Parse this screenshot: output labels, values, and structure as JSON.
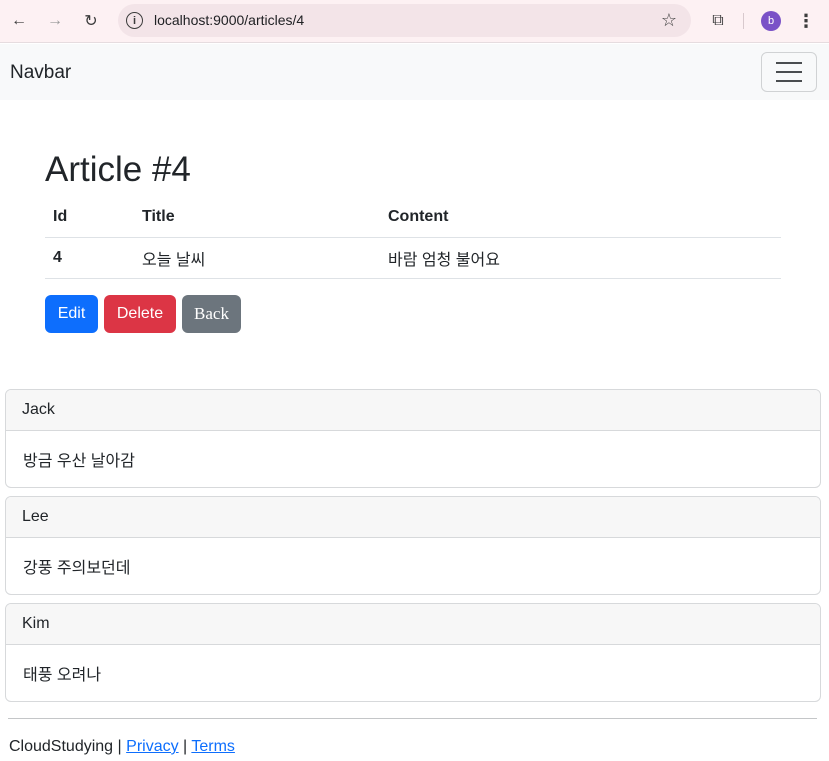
{
  "browser": {
    "url": "localhost:9000/articles/4",
    "profile_initial": "b"
  },
  "navbar": {
    "brand": "Navbar"
  },
  "article": {
    "title": "Article #4",
    "columns": [
      "Id",
      "Title",
      "Content"
    ],
    "row": {
      "id": "4",
      "title": "오늘 날씨",
      "content": "바람 엄청 불어요"
    },
    "buttons": {
      "edit": "Edit",
      "delete": "Delete",
      "back": "Back"
    }
  },
  "comments": [
    {
      "author": "Jack",
      "body": "방금 우산 날아감"
    },
    {
      "author": "Lee",
      "body": "강풍 주의보던데"
    },
    {
      "author": "Kim",
      "body": "태풍 오려나"
    }
  ],
  "footer": {
    "brand": "CloudStudying",
    "separator": "|",
    "privacy": "Privacy",
    "terms": "Terms"
  },
  "colors": {
    "primary": "#0d6efd",
    "danger": "#dc3545",
    "secondary": "#6c757d"
  }
}
